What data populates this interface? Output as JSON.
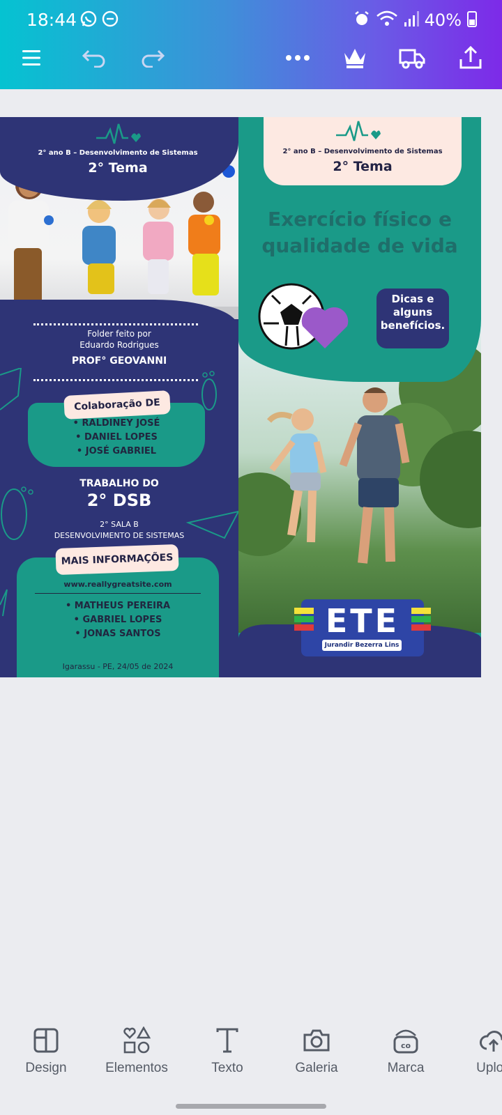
{
  "status_bar": {
    "time": "18:44",
    "battery": "40%"
  },
  "toolbar": {
    "more_icon": "more-horizontal-icon",
    "crown_icon": "crown-icon",
    "truck_icon": "truck-icon",
    "share_icon": "share-icon"
  },
  "design": {
    "left_panel": {
      "subtitle": "2° ano B – Desenvolvimento de Sistemas",
      "tema": "2° Tema",
      "folder_line1": "Folder feito por",
      "folder_line2": "Eduardo Rodrigues",
      "prof": "PROF° GEOVANNI",
      "colaboracao_label": "Colaboração DE",
      "colaboradores": [
        "• RALDINEY JOSÉ",
        "• DANIEL LOPES",
        "• JOSÉ GABRIEL"
      ],
      "trabalho_do": "TRABALHO DO",
      "turma": "2° DSB",
      "sala": "2° SALA B",
      "curso": "DESENVOLVIMENTO DE SISTEMAS",
      "mais_info_label": "MAIS INFORMAÇÕES",
      "website": "www.reallygreatsite.com",
      "membros": [
        "• MATHEUS PEREIRA",
        "• GABRIEL LOPES",
        "• JONAS SANTOS"
      ],
      "local_data": "Igarassu - PE, 24/05 de 2024"
    },
    "right_panel": {
      "subtitle": "2° ano B – Desenvolvimento de Sistemas",
      "tema": "2° Tema",
      "headline_1": "Exercício físico e",
      "headline_2": "qualidade de vida",
      "bubble_1": "Dicas e",
      "bubble_2": "alguns",
      "bubble_3": "benefícios.",
      "logo_text": "ETE",
      "logo_sub": "Jurandir Bezerra Lins"
    }
  },
  "bottom_nav": [
    {
      "label": "Design"
    },
    {
      "label": "Elementos"
    },
    {
      "label": "Texto"
    },
    {
      "label": "Galeria"
    },
    {
      "label": "Marca"
    },
    {
      "label": "Uploa"
    }
  ],
  "colors": {
    "navy": "#2e3476",
    "teal": "#1a9a88",
    "peach": "#fde9e2",
    "purple": "#9b59c9"
  }
}
